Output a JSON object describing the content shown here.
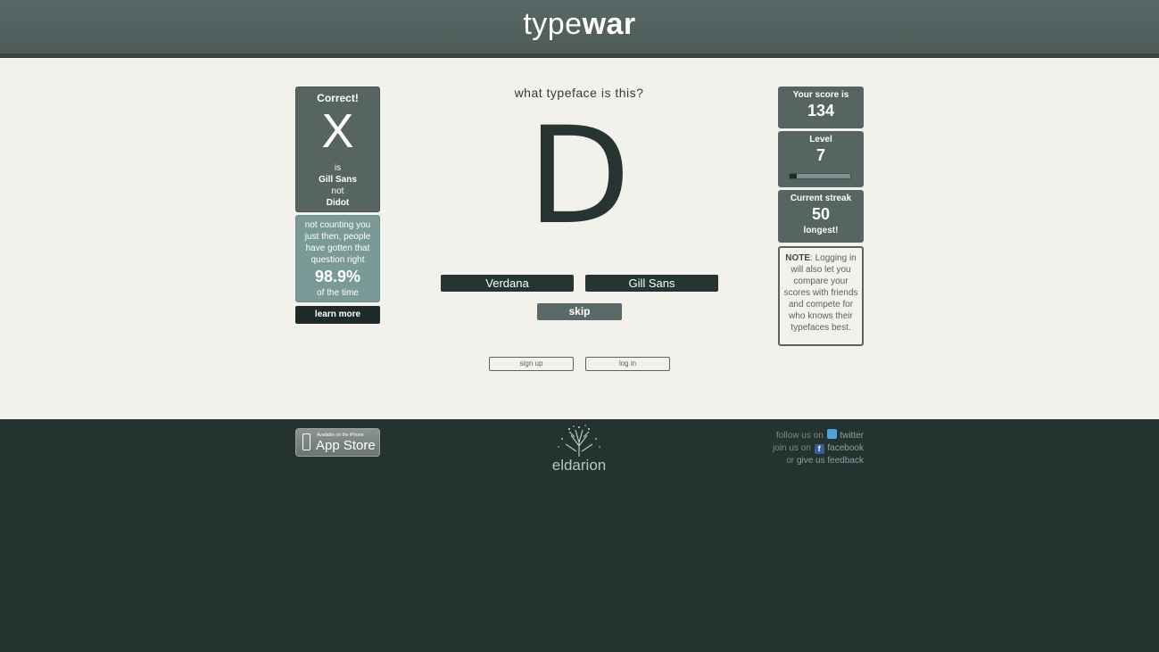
{
  "header": {
    "logo_light": "type",
    "logo_bold": "war"
  },
  "result": {
    "title": "Correct!",
    "mark": "X",
    "line1": "is",
    "correct_font": "Gill Sans",
    "line2": "not",
    "other_font": "Didot"
  },
  "stats": {
    "text": "not counting you just then, people have gotten that question right",
    "percent": "98.9%",
    "foot": "of the time"
  },
  "learn_more": "learn more",
  "question": "what typeface is this?",
  "specimen": "D",
  "choices": {
    "a": "Verdana",
    "b": "Gill Sans"
  },
  "skip": "skip",
  "auth": {
    "signup": "sign up",
    "login": "log in"
  },
  "score": {
    "label": "Your score is",
    "value": "134"
  },
  "level": {
    "label": "Level",
    "value": "7",
    "progress": 0.12
  },
  "streak": {
    "label": "Current streak",
    "value": "50",
    "foot": "longest!"
  },
  "note": {
    "label": "NOTE",
    "text": ": Logging in will also let you compare your scores with friends and compete for who knows their typefaces best."
  },
  "footer": {
    "appstore_small": "Available on the iPhone",
    "appstore_big": "App Store",
    "brand": "eldarion",
    "follow_prefix": "follow us on",
    "twitter": "twitter",
    "join_prefix": "join us on",
    "facebook": "facebook",
    "feedback_prefix": "or",
    "feedback": "give us feedback"
  },
  "colors": {
    "accent": "#566462",
    "dark": "#263432",
    "footer": "#243230"
  },
  "icons": [
    "phone-icon",
    "eldarion-tree-icon",
    "twitter-icon",
    "facebook-icon"
  ]
}
